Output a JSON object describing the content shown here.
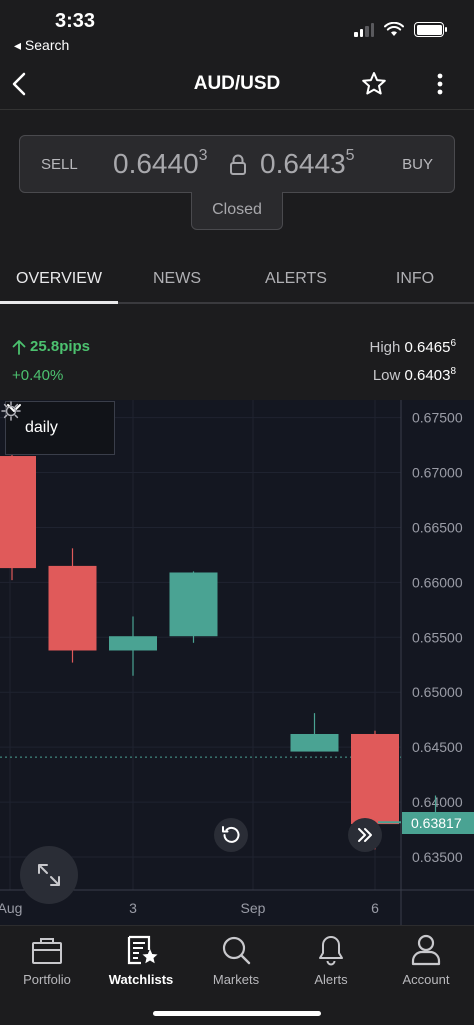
{
  "status_bar": {
    "time": "3:33",
    "back_label": "◂ Search"
  },
  "nav": {
    "title": "AUD/USD"
  },
  "quote": {
    "sell_label": "SELL",
    "sell_price": "0.6440",
    "sell_pipette": "3",
    "buy_label": "BUY",
    "buy_price": "0.6443",
    "buy_pipette": "5",
    "market_status": "Closed"
  },
  "tabs": [
    {
      "label": "OVERVIEW",
      "active": true
    },
    {
      "label": "NEWS",
      "active": false
    },
    {
      "label": "ALERTS",
      "active": false
    },
    {
      "label": "INFO",
      "active": false
    }
  ],
  "summary": {
    "change_pips": "25.8pips",
    "change_percent": "+0.40%",
    "high_label": "High",
    "high_value": "0.6465",
    "high_pipette": "6",
    "low_label": "Low",
    "low_value": "0.6403",
    "low_pipette": "8"
  },
  "chart": {
    "interval": "daily",
    "current_price_label": "0.63817",
    "colors": {
      "up": "#4aa393",
      "down": "#e05a5a",
      "bg": "#141721"
    }
  },
  "chart_data": {
    "type": "candlestick",
    "x_tick_labels": [
      "Aug",
      "3",
      "Sep",
      "6"
    ],
    "y_tick_labels": [
      "0.67500",
      "0.67000",
      "0.66500",
      "0.66000",
      "0.65500",
      "0.65000",
      "0.64500",
      "0.64000",
      "0.63500"
    ],
    "ylim": [
      0.632,
      0.6766
    ],
    "current_price": 0.63817,
    "reference_line": 0.6441,
    "candles": [
      {
        "open": 0.6715,
        "high": 0.6725,
        "low": 0.6602,
        "close": 0.6613
      },
      {
        "open": 0.6615,
        "high": 0.6631,
        "low": 0.6527,
        "close": 0.6538
      },
      {
        "open": 0.6538,
        "high": 0.6569,
        "low": 0.6515,
        "close": 0.6551
      },
      {
        "open": 0.6551,
        "high": 0.661,
        "low": 0.6545,
        "close": 0.6609
      },
      null,
      {
        "open": 0.6446,
        "high": 0.6481,
        "low": 0.6446,
        "close": 0.6462
      },
      {
        "open": 0.6462,
        "high": 0.6465,
        "low": 0.6357,
        "close": 0.638
      },
      {
        "open": 0.638,
        "high": 0.6406,
        "low": 0.6378,
        "close": 0.6382
      }
    ],
    "grid": true
  },
  "tab_bar": [
    {
      "label": "Portfolio",
      "icon": "briefcase-icon",
      "active": false
    },
    {
      "label": "Watchlists",
      "icon": "watchlist-star-icon",
      "active": true
    },
    {
      "label": "Markets",
      "icon": "search-icon",
      "active": false
    },
    {
      "label": "Alerts",
      "icon": "bell-icon",
      "active": false
    },
    {
      "label": "Account",
      "icon": "person-icon",
      "active": false
    }
  ]
}
